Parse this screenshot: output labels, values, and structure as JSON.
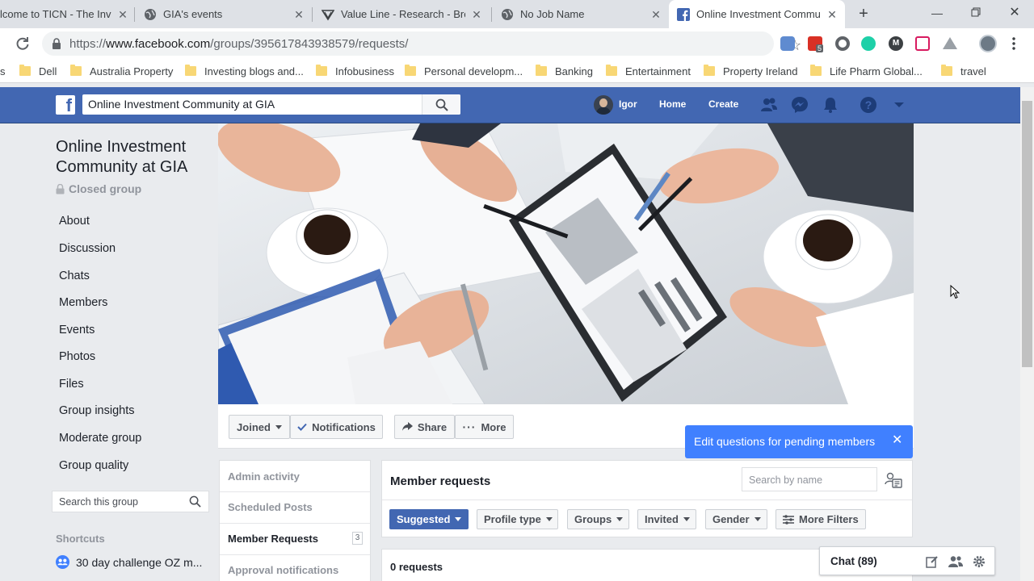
{
  "browser": {
    "tabs": [
      {
        "title": "lcome to TICN - The Inve",
        "icon": "globe-icon"
      },
      {
        "title": "GIA's events",
        "icon": "globe-icon"
      },
      {
        "title": "Value Line - Research - Bro",
        "icon": "value-line-icon"
      },
      {
        "title": "No Job Name",
        "icon": "globe-icon"
      },
      {
        "title": "Online Investment Commu",
        "icon": "facebook-icon"
      }
    ],
    "url_scheme": "https://",
    "url_host": "www.facebook.com",
    "url_path": "/groups/395617843938579/requests/",
    "extension_badge": "5",
    "bookmarks": [
      "s",
      "Dell",
      "Australia Property",
      "Investing blogs and...",
      "Infobusiness",
      "Personal developm...",
      "Banking",
      "Entertainment",
      "Property Ireland",
      "Life Pharm Global...",
      "travel"
    ]
  },
  "facebook": {
    "search_value": "Online Investment Community at GIA",
    "user_name": "Igor",
    "nav_home": "Home",
    "nav_create": "Create"
  },
  "group": {
    "name": "Online Investment Community at GIA",
    "privacy": "Closed group",
    "nav": [
      "About",
      "Discussion",
      "Chats",
      "Members",
      "Events",
      "Photos",
      "Files",
      "Group insights",
      "Moderate group",
      "Group quality"
    ],
    "search_placeholder": "Search this group",
    "shortcuts_label": "Shortcuts",
    "shortcut": "30 day challenge OZ m..."
  },
  "actions": {
    "joined": "Joined",
    "notifications": "Notifications",
    "share": "Share",
    "more": "More"
  },
  "tooltip": {
    "text": "Edit questions for pending members"
  },
  "admin": {
    "items": [
      "Admin activity",
      "Scheduled Posts",
      "Member Requests",
      "Approval notifications"
    ],
    "member_requests_count": "3"
  },
  "requests": {
    "title": "Member requests",
    "search_placeholder": "Search by name",
    "filters": [
      "Suggested",
      "Profile type",
      "Groups",
      "Invited",
      "Gender",
      "More Filters"
    ],
    "count_text": "0 requests"
  },
  "chat": {
    "label": "Chat (89)"
  },
  "colors": {
    "facebook_blue": "#4267b2",
    "tooltip_blue": "#4080ff"
  }
}
